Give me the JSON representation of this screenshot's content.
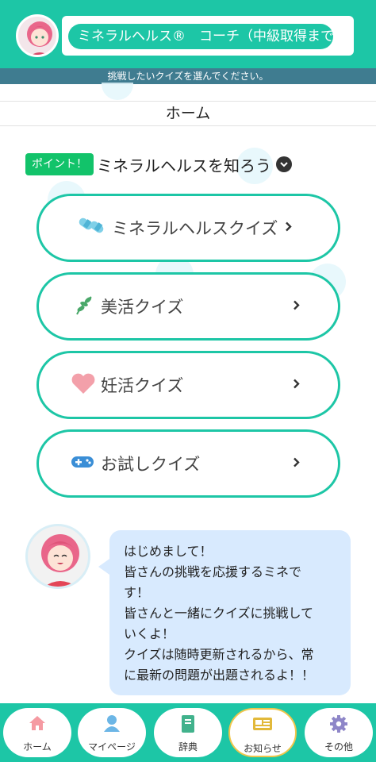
{
  "header": {
    "title": "ミネラルヘルス®　コーチ（中級取得まで）",
    "subtitle": "挑戦したいクイズを選んでください。"
  },
  "page": {
    "title": "ホーム"
  },
  "section": {
    "badge": "ポイント！",
    "title": "ミネラルヘルスを知ろう"
  },
  "quizzes": [
    {
      "label": "ミネラルヘルスクイズ",
      "icon": "capsule-icon"
    },
    {
      "label": "美活クイズ",
      "icon": "leaf-icon"
    },
    {
      "label": "妊活クイズ",
      "icon": "heart-icon"
    },
    {
      "label": "お試しクイズ",
      "icon": "gamepad-icon"
    }
  ],
  "coach_message": {
    "lines": [
      "はじめまして！",
      "皆さんの挑戦を応援するミネで",
      "す！",
      "皆さんと一緒にクイズに挑戦して",
      "いくよ！",
      "クイズは随時更新されるから、常",
      "に最新の問題が出題されるよ！！"
    ]
  },
  "bottom_nav": [
    {
      "label": "ホーム",
      "icon": "home-icon",
      "color": "#f59aa2"
    },
    {
      "label": "マイページ",
      "icon": "user-icon",
      "color": "#6cb6e6"
    },
    {
      "label": "辞典",
      "icon": "book-icon",
      "color": "#41b28c"
    },
    {
      "label": "お知らせ",
      "icon": "news-icon",
      "color": "#e2b93a"
    },
    {
      "label": "その他",
      "icon": "gear-icon",
      "color": "#8e86c8"
    }
  ],
  "colors": {
    "accent": "#1dc6a6",
    "subbar": "#3f7c90",
    "badge": "#12c36a",
    "speech": "#d8eafe"
  }
}
